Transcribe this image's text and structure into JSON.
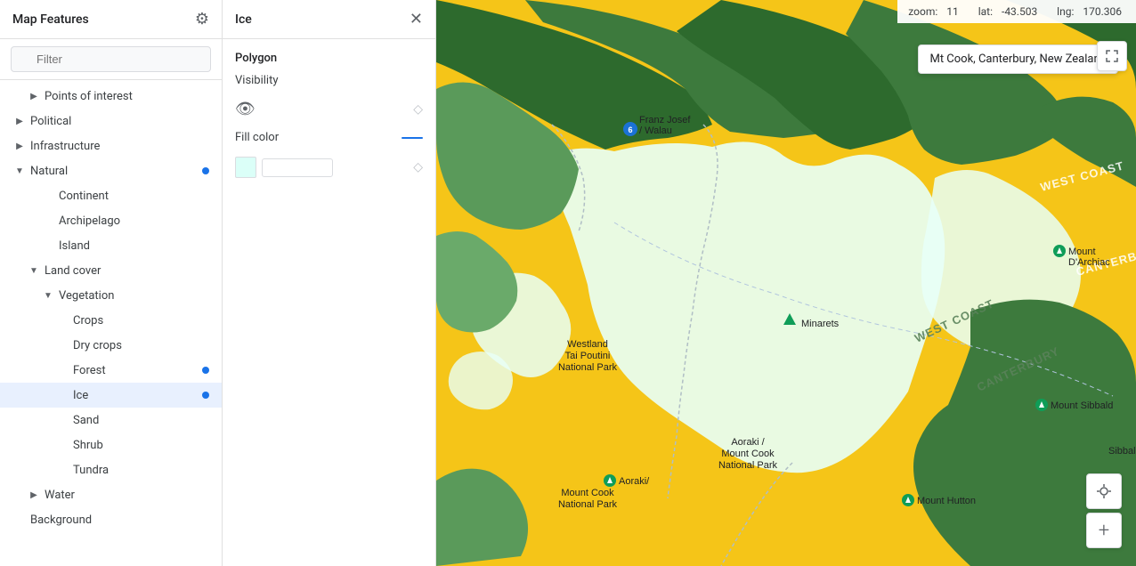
{
  "sidebar": {
    "title": "Map Features",
    "filter_placeholder": "Filter",
    "items": [
      {
        "id": "points-of-interest",
        "label": "Points of interest",
        "indent": 1,
        "chevron": "▶",
        "has_dot": false,
        "selected": false
      },
      {
        "id": "political",
        "label": "Political",
        "indent": 0,
        "chevron": "▶",
        "has_dot": false,
        "selected": false
      },
      {
        "id": "infrastructure",
        "label": "Infrastructure",
        "indent": 0,
        "chevron": "▶",
        "has_dot": false,
        "selected": false
      },
      {
        "id": "natural",
        "label": "Natural",
        "indent": 0,
        "chevron": "▼",
        "has_dot": true,
        "selected": false
      },
      {
        "id": "continent",
        "label": "Continent",
        "indent": 2,
        "chevron": "",
        "has_dot": false,
        "selected": false
      },
      {
        "id": "archipelago",
        "label": "Archipelago",
        "indent": 2,
        "chevron": "",
        "has_dot": false,
        "selected": false
      },
      {
        "id": "island",
        "label": "Island",
        "indent": 2,
        "chevron": "",
        "has_dot": false,
        "selected": false
      },
      {
        "id": "land-cover",
        "label": "Land cover",
        "indent": 1,
        "chevron": "▼",
        "has_dot": false,
        "selected": false
      },
      {
        "id": "vegetation",
        "label": "Vegetation",
        "indent": 2,
        "chevron": "▼",
        "has_dot": false,
        "selected": false
      },
      {
        "id": "crops",
        "label": "Crops",
        "indent": 3,
        "chevron": "",
        "has_dot": false,
        "selected": false
      },
      {
        "id": "dry-crops",
        "label": "Dry crops",
        "indent": 3,
        "chevron": "",
        "has_dot": false,
        "selected": false
      },
      {
        "id": "forest",
        "label": "Forest",
        "indent": 3,
        "chevron": "",
        "has_dot": true,
        "selected": false
      },
      {
        "id": "ice",
        "label": "Ice",
        "indent": 3,
        "chevron": "",
        "has_dot": true,
        "selected": true
      },
      {
        "id": "sand",
        "label": "Sand",
        "indent": 3,
        "chevron": "",
        "has_dot": false,
        "selected": false
      },
      {
        "id": "shrub",
        "label": "Shrub",
        "indent": 3,
        "chevron": "",
        "has_dot": false,
        "selected": false
      },
      {
        "id": "tundra",
        "label": "Tundra",
        "indent": 3,
        "chevron": "",
        "has_dot": false,
        "selected": false
      },
      {
        "id": "water",
        "label": "Water",
        "indent": 1,
        "chevron": "▶",
        "has_dot": false,
        "selected": false
      },
      {
        "id": "background",
        "label": "Background",
        "indent": 0,
        "chevron": "",
        "has_dot": false,
        "selected": false
      }
    ]
  },
  "panel": {
    "title": "Ice",
    "section": "Polygon",
    "visibility_label": "Visibility",
    "fill_color_label": "Fill color",
    "color_hex": "DBFFF8",
    "color_bg": "#DBFFF8"
  },
  "map": {
    "zoom_label": "zoom:",
    "zoom_value": "11",
    "lat_label": "lat:",
    "lat_value": "-43.503",
    "lng_label": "lng:",
    "lng_value": "170.306",
    "location_tooltip": "Mt Cook, Canterbury, New Zealand",
    "places": [
      {
        "id": "franz-josef",
        "label": "Franz Josef\n/ Walau",
        "badge": "6"
      },
      {
        "id": "minarets",
        "label": "Minarets"
      },
      {
        "id": "westland-tai-poutini",
        "label": "Westland\nTai Poutini\nNational Park"
      },
      {
        "id": "mount-darchiac",
        "label": "Mount\nD'Archiac"
      },
      {
        "id": "aoraki-mount-cook-1",
        "label": "Aoraki /\nMount Cook\nNational Park"
      },
      {
        "id": "aoraki-mount-cook-2",
        "label": "Aoraki/\nMount Cook\nNational Park"
      },
      {
        "id": "mount-sibbald",
        "label": "Mount Sibbald"
      },
      {
        "id": "mount-hutton",
        "label": "Mount Hutton"
      },
      {
        "id": "sibbald",
        "label": "Sibbald"
      }
    ],
    "regions": [
      {
        "id": "west-coast-1",
        "label": "WEST COAST"
      },
      {
        "id": "canterbury-1",
        "label": "CANTERBURY"
      },
      {
        "id": "west-coast-2",
        "label": "WEST COAST"
      },
      {
        "id": "canterbury-2",
        "label": "CANTERBURY"
      }
    ]
  }
}
